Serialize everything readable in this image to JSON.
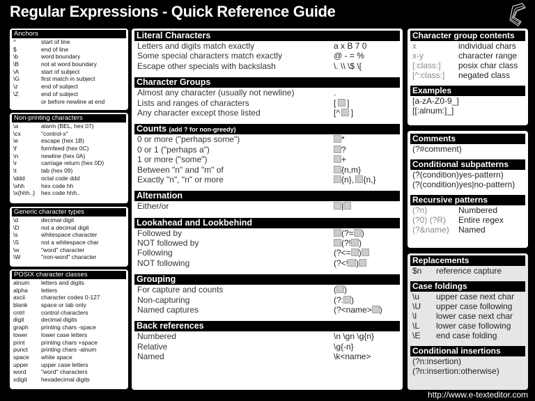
{
  "title": "Regular Expressions - Quick Reference Guide",
  "url": "http://www.e-texteditor.com",
  "anchors": {
    "header": "Anchors",
    "rows": [
      {
        "k": "^",
        "v": "start of line"
      },
      {
        "k": "$",
        "v": "end of line"
      },
      {
        "k": "\\b",
        "v": "word boundary"
      },
      {
        "k": "\\B",
        "v": "not at word boundary"
      },
      {
        "k": "\\A",
        "v": "start of subject"
      },
      {
        "k": "\\G",
        "v": "first match in subject"
      },
      {
        "k": "\\z",
        "v": "end of subject"
      },
      {
        "k": "\\Z",
        "v": "end of subject"
      },
      {
        "k": "",
        "v": "or before newline at end"
      }
    ]
  },
  "nonprinting": {
    "header": "Non-printing characters",
    "rows": [
      {
        "k": "\\a",
        "v": "alarm (BEL, hex 07)"
      },
      {
        "k": "\\cx",
        "v": "\"control-x\""
      },
      {
        "k": "\\e",
        "v": "escape (hex 1B)"
      },
      {
        "k": "\\f",
        "v": "formfeed (hex 0C)"
      },
      {
        "k": "\\n",
        "v": "newline (hex 0A)"
      },
      {
        "k": "\\r",
        "v": "carriage return (hex 0D)"
      },
      {
        "k": "\\t",
        "v": "tab (hex 09)"
      },
      {
        "k": "\\ddd",
        "v": "octal code ddd"
      },
      {
        "k": "\\xhh",
        "v": "hex code hh"
      },
      {
        "k": "\\x{hhh..}",
        "v": "hex code hhh.."
      }
    ]
  },
  "generic": {
    "header": "Generic character types",
    "rows": [
      {
        "k": "\\d",
        "v": "decimal digit"
      },
      {
        "k": "\\D",
        "v": "not a decimal digit"
      },
      {
        "k": "\\s",
        "v": "whitespace character"
      },
      {
        "k": "\\S",
        "v": "not a whitespace char"
      },
      {
        "k": "\\w",
        "v": "\"word\" character"
      },
      {
        "k": "\\W",
        "v": "\"non-word\" character"
      }
    ]
  },
  "posix": {
    "header": "POSIX character classes",
    "rows": [
      {
        "k": "alnum",
        "v": "letters and digits"
      },
      {
        "k": "alpha",
        "v": "letters"
      },
      {
        "k": "ascii",
        "v": "character codes 0-127"
      },
      {
        "k": "blank",
        "v": "space or tab only"
      },
      {
        "k": "cntrl",
        "v": "control characters"
      },
      {
        "k": "digit",
        "v": "decimal digits"
      },
      {
        "k": "graph",
        "v": "printing chars -space"
      },
      {
        "k": "lower",
        "v": "lower case letters"
      },
      {
        "k": "print",
        "v": "printing chars +space"
      },
      {
        "k": "punct",
        "v": "printing chars -alnum"
      },
      {
        "k": "space",
        "v": "white space"
      },
      {
        "k": "upper",
        "v": "upper case letters"
      },
      {
        "k": "word",
        "v": "\"word\" characters"
      },
      {
        "k": "xdigit",
        "v": "hexadecimal digits"
      }
    ]
  },
  "literal": {
    "header": "Literal Characters",
    "rows": [
      {
        "d": "Letters and digits match exactly",
        "c": "a x B 7 0"
      },
      {
        "d": "Some special characters match exactly",
        "c": "@ - = %"
      },
      {
        "d": "Escape other specials with backslash",
        "c": "\\. \\\\ \\$ \\["
      }
    ]
  },
  "groups": {
    "header": "Character Groups",
    "rows": [
      {
        "d": "Almost any character (usually not newline)",
        "c": "."
      },
      {
        "d": "Lists and ranges of characters",
        "c": "[ ▪ ]"
      },
      {
        "d": "Any character except those listed",
        "c": "[^ ▪ ]"
      }
    ]
  },
  "counts": {
    "header": "Counts",
    "note": "(add ? for non-greedy)",
    "rows": [
      {
        "d": "0 or more (\"perhaps some\")",
        "c": "▪*"
      },
      {
        "d": "0 or 1 (\"perhaps a\")",
        "c": "▪?"
      },
      {
        "d": "1 or more (\"some\")",
        "c": "▪+"
      },
      {
        "d": "Between \"n\" and \"m\" of",
        "c": "▪{n,m}"
      },
      {
        "d": "Exactly \"n\", \"n\" or more",
        "c": "▪{n}, ▪{n,}"
      }
    ]
  },
  "alternation": {
    "header": "Alternation",
    "rows": [
      {
        "d": "Either/or",
        "c": "▪|▪"
      }
    ]
  },
  "lookaround": {
    "header": "Lookahead and Lookbehind",
    "rows": [
      {
        "d": "Followed by",
        "c": "▪(?=▪)"
      },
      {
        "d": "NOT followed by",
        "c": "▪(?!▪)"
      },
      {
        "d": "Following",
        "c": "(?<=▪)▪"
      },
      {
        "d": "NOT following",
        "c": "(?<!▪)▪"
      }
    ]
  },
  "grouping": {
    "header": "Grouping",
    "rows": [
      {
        "d": "For capture and counts",
        "c": "(▪)"
      },
      {
        "d": "Non-capturing",
        "c": "(?:▪)"
      },
      {
        "d": "Named captures",
        "c": "(?<name>▪)"
      }
    ]
  },
  "backrefs": {
    "header": "Back references",
    "rows": [
      {
        "d": "Numbered",
        "c": "\\n \\gn \\g{n}"
      },
      {
        "d": "Relative",
        "c": "\\g{-n}"
      },
      {
        "d": "Named",
        "c": "\\k<name>"
      }
    ]
  },
  "cgcontents": {
    "header": "Character group contents",
    "rows": [
      {
        "k": "x",
        "v": "individual chars"
      },
      {
        "k": "x-y",
        "v": "character range"
      },
      {
        "k": "[:class:]",
        "v": "posix char class"
      },
      {
        "k": "[^:class:]",
        "v": "negated class"
      }
    ]
  },
  "examples": {
    "header": "Examples",
    "rows": [
      "[a-zA-Z0-9_]",
      "[[:alnum:]_]"
    ]
  },
  "comments": {
    "header": "Comments",
    "rows": [
      "(?#comment)"
    ]
  },
  "conditional": {
    "header": "Conditional subpatterns",
    "rows": [
      "(?(condition)yes-pattern)",
      "(?(condition)yes|no-pattern)"
    ]
  },
  "recursive": {
    "header": "Recursive patterns",
    "rows": [
      {
        "k": "(?n)",
        "v": "Numbered"
      },
      {
        "k": "(?0) (?R)",
        "v": "Entire regex"
      },
      {
        "k": "(?&name)",
        "v": "Named"
      }
    ]
  },
  "replacements": {
    "header": "Replacements",
    "rows": [
      {
        "k": "$n",
        "v": "reference capture"
      }
    ]
  },
  "casefold": {
    "header": "Case foldings",
    "rows": [
      {
        "k": "\\u",
        "v": "upper case next char"
      },
      {
        "k": "\\U",
        "v": "upper case following"
      },
      {
        "k": "\\l",
        "v": "lower case next char"
      },
      {
        "k": "\\L",
        "v": "lower case following"
      },
      {
        "k": "\\E",
        "v": "end case folding"
      }
    ]
  },
  "condins": {
    "header": "Conditional insertions",
    "rows": [
      "(?n:insertion)",
      "(?n:insertion:otherwise)"
    ]
  }
}
